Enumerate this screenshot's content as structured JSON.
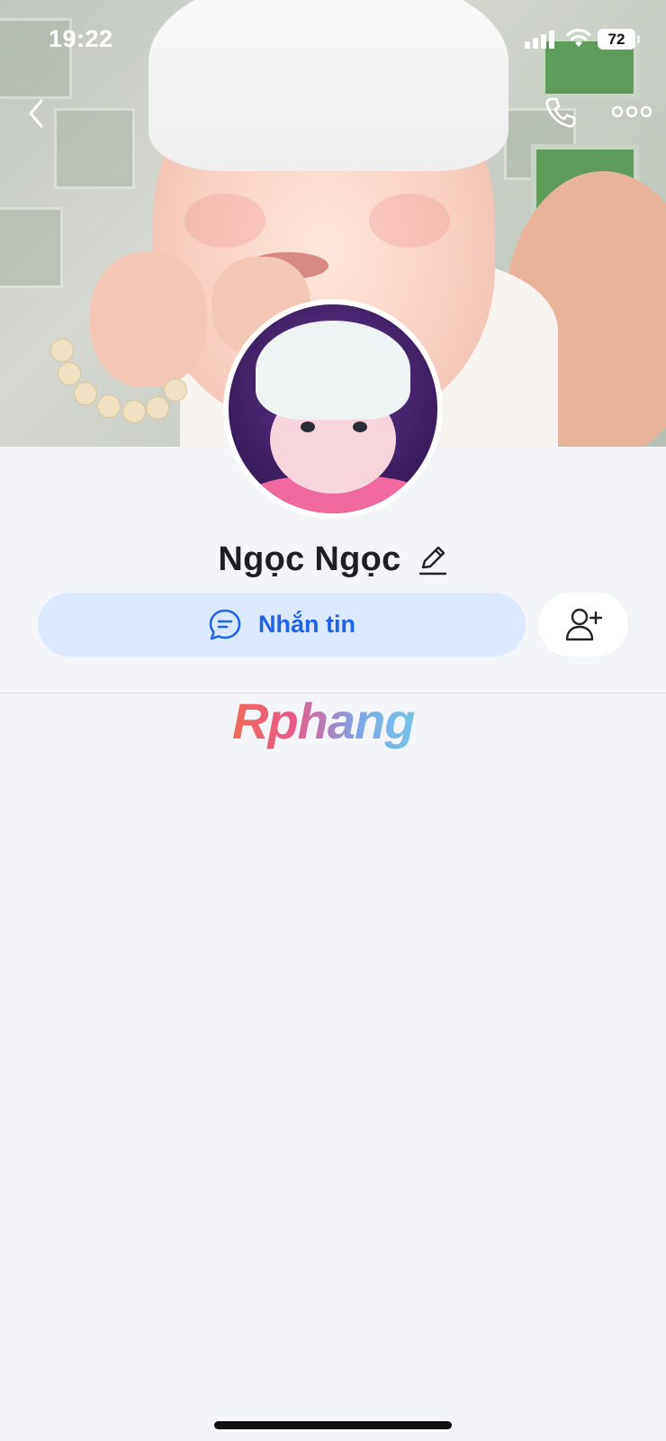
{
  "status_bar": {
    "time": "19:22",
    "battery": "72"
  },
  "profile": {
    "name": "Ngọc Ngọc"
  },
  "actions": {
    "message_label": "Nhắn tin"
  },
  "watermark": {
    "text": "Rphang"
  },
  "icons": {
    "back": "chevron-left-icon",
    "call": "phone-icon",
    "more": "more-horizontal-icon",
    "edit": "pencil-icon",
    "message": "chat-bubble-icon",
    "add_friend": "add-user-icon"
  },
  "colors": {
    "accent": "#1f63e6",
    "message_button_bg": "#dce8fd",
    "page_bg": "#f4f5f8"
  }
}
